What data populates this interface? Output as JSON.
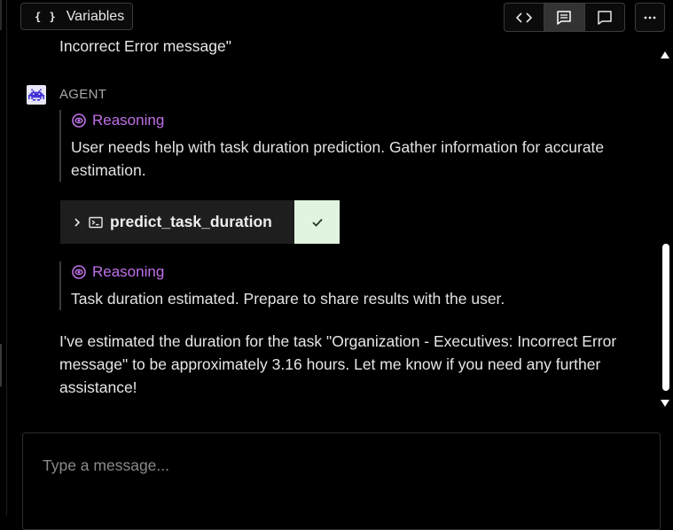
{
  "toolbar": {
    "variables_label": "Variables",
    "variables_icon": "braces-icon",
    "view_modes": [
      {
        "name": "code-view",
        "icon": "code-icon"
      },
      {
        "name": "message-view",
        "icon": "message-lines-icon",
        "active": true
      },
      {
        "name": "chat-view",
        "icon": "chat-bubble-icon"
      }
    ],
    "more_icon": "ellipsis-icon"
  },
  "conversation": {
    "previous_message_tail": "Incorrect Error message\"",
    "agent": {
      "label": "AGENT",
      "reasoning_1": {
        "title": "Reasoning",
        "text": "User needs help with task duration prediction. Gather information for accurate estimation."
      },
      "tool_call": {
        "name": "predict_task_duration",
        "status": "success"
      },
      "reasoning_2": {
        "title": "Reasoning",
        "text": "Task duration estimated. Prepare to share results with the user."
      },
      "final_message": "I've estimated the duration for the task \"Organization - Executives: Incorrect Error message\" to be approximately 3.16 hours. Let me know if you need any further assistance!"
    }
  },
  "composer": {
    "placeholder": "Type a message...",
    "value": ""
  },
  "colors": {
    "background": "#000000",
    "reasoning_accent": "#c070e8",
    "tool_success_bg": "#e1f4df",
    "tool_bg": "#1e1e1e"
  }
}
